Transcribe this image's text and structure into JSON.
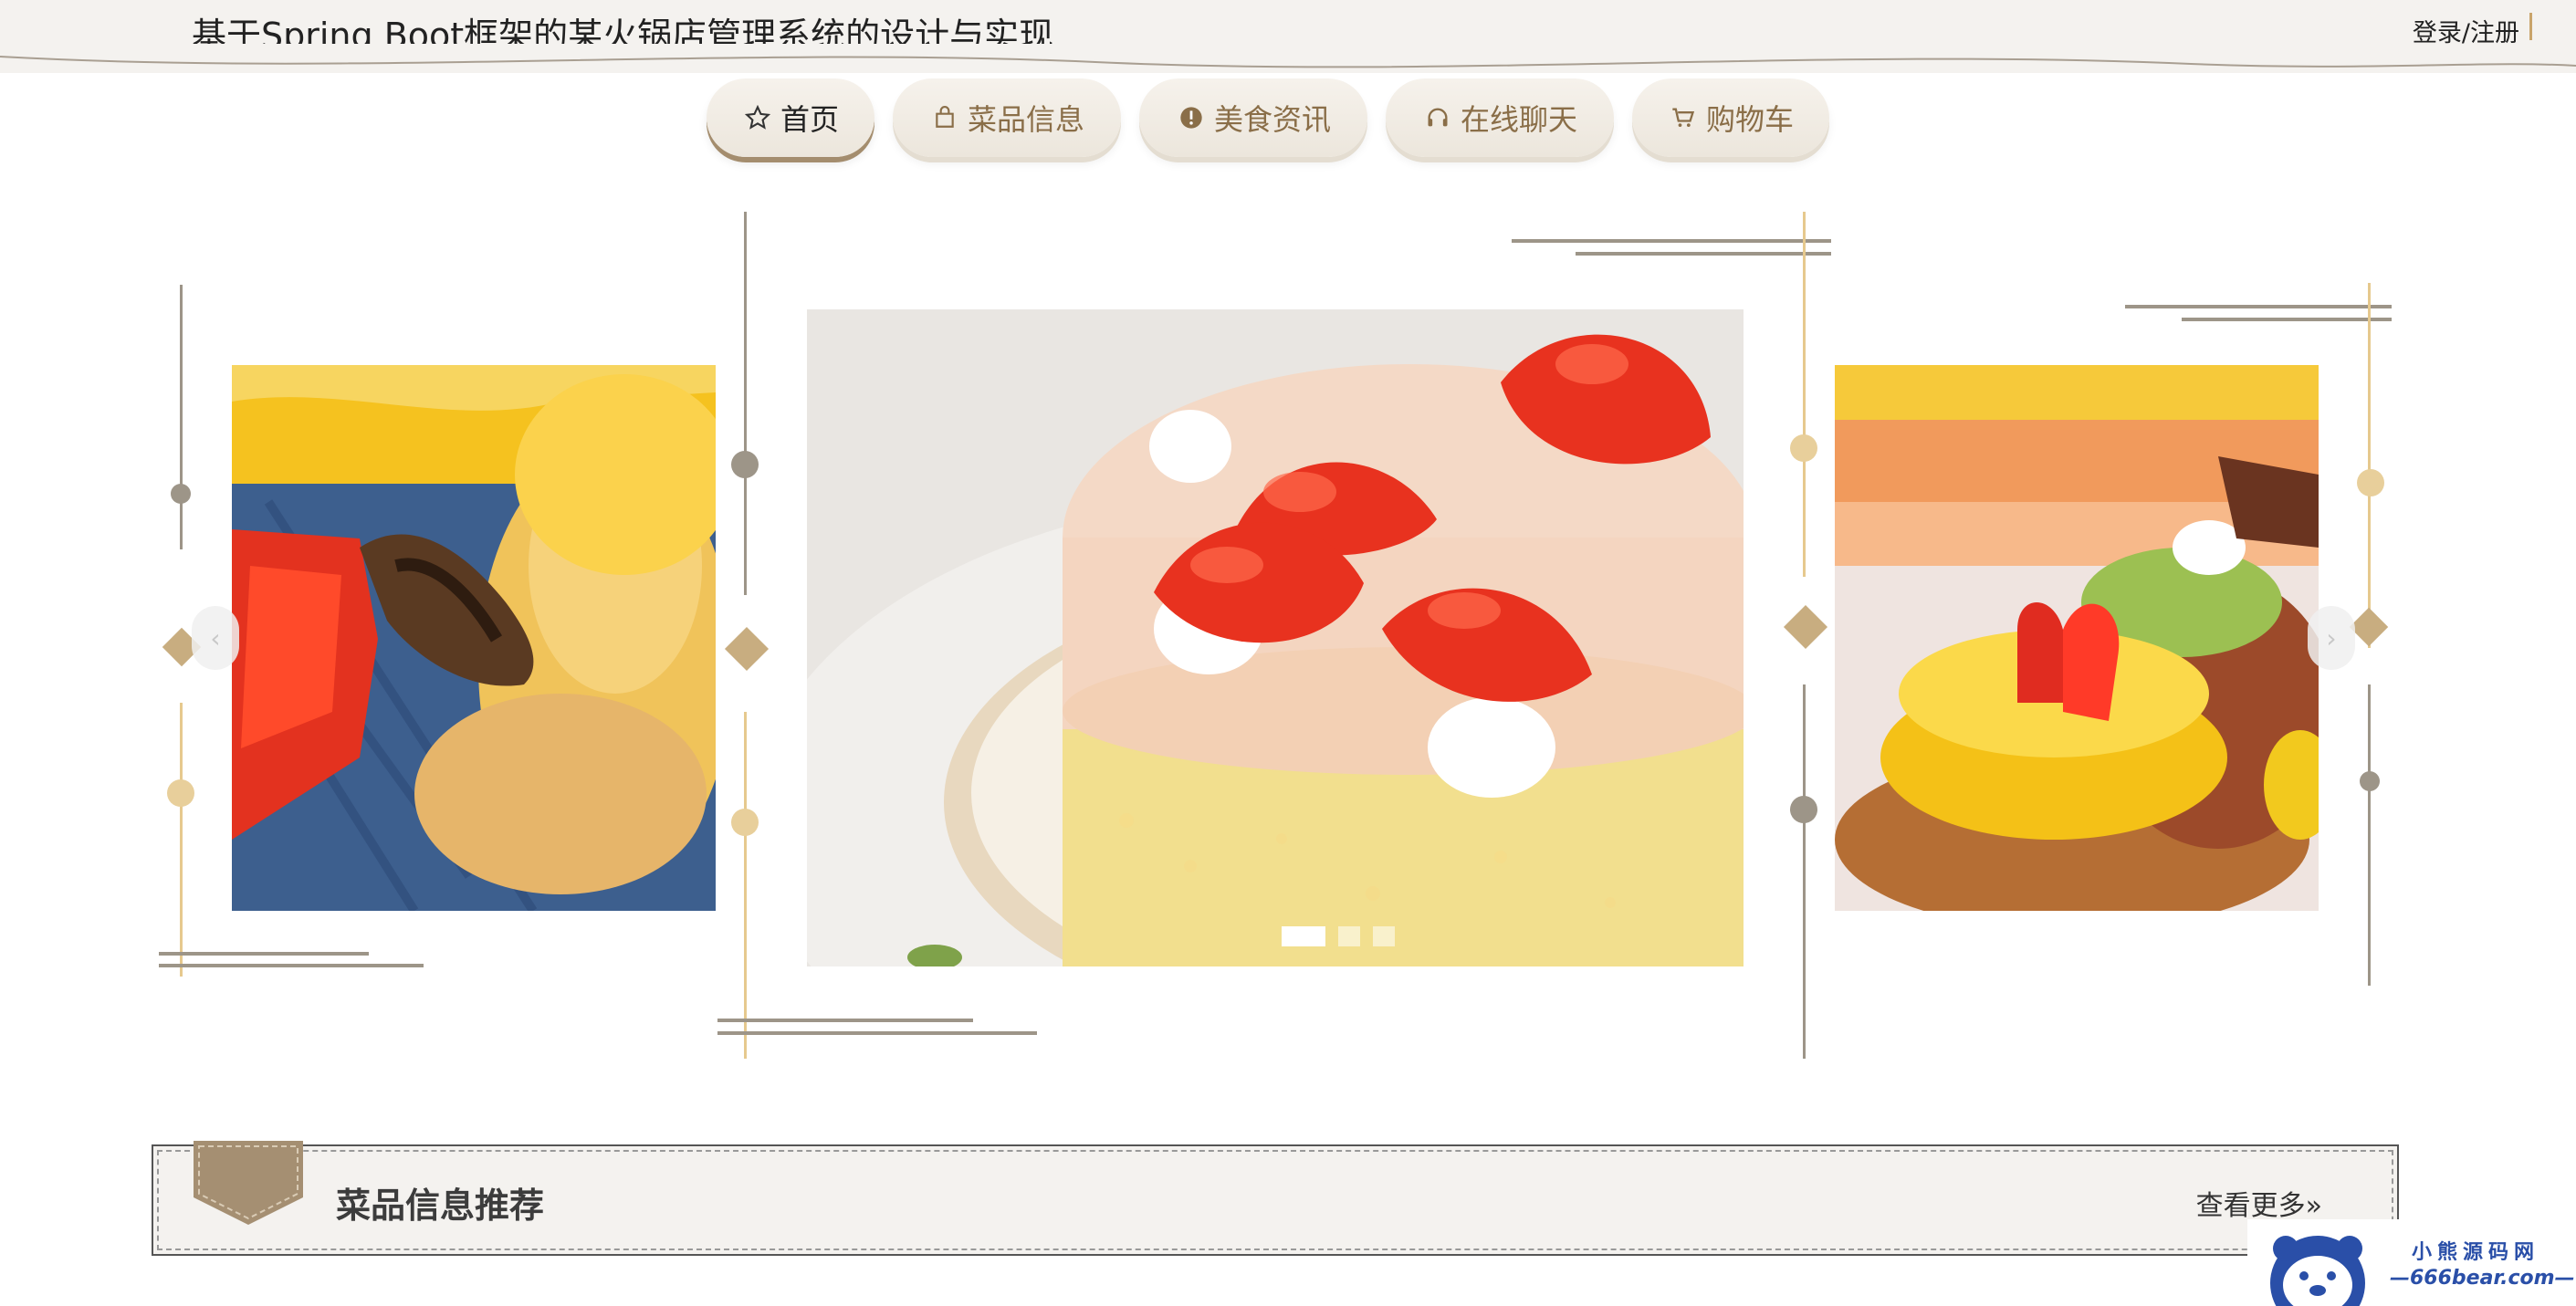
{
  "header": {
    "title": "基于Spring Boot框架的某火锅店管理系统的设计与实现",
    "login": "登录/注册"
  },
  "nav": {
    "items": [
      {
        "label": "首页",
        "icon": "star-icon",
        "active": true
      },
      {
        "label": "菜品信息",
        "icon": "bag-icon"
      },
      {
        "label": "美食资讯",
        "icon": "info-icon"
      },
      {
        "label": "在线聊天",
        "icon": "headset-icon"
      },
      {
        "label": "购物车",
        "icon": "cart-icon"
      }
    ]
  },
  "carousel": {
    "slides": [
      "pastry-fruit-image",
      "strawberry-cake-image",
      "fruit-tart-image"
    ],
    "active_index": 0,
    "indicator_count": 3,
    "prev_arrow": "‹",
    "next_arrow": "›"
  },
  "recommend": {
    "title": "菜品信息推荐",
    "more": "查看更多»"
  },
  "watermark": {
    "name": "小熊源码网",
    "url": "—666bear.com—"
  },
  "colors": {
    "accent_gold": "#c8ad80",
    "nav_text": "#8a6e48",
    "header_bg": "#f4f2ef",
    "deco_gray": "#9d9588"
  }
}
